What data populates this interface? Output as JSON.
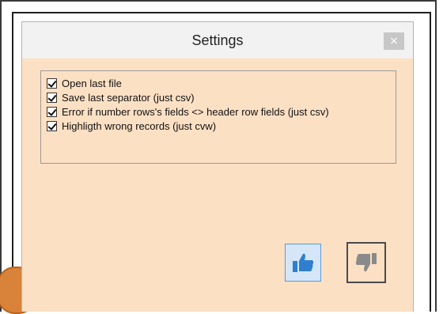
{
  "window": {
    "title": "Settings",
    "close_glyph": "×"
  },
  "options": [
    {
      "label": "Open last file",
      "checked": true
    },
    {
      "label": "Save last separator (just csv)",
      "checked": true
    },
    {
      "label": "Error if number rows's fields <> header row fields (just csv)",
      "checked": true
    },
    {
      "label": "Highligth wrong records (just cvw)",
      "checked": true
    }
  ],
  "buttons": {
    "ok_icon": "thumbs-up-icon",
    "cancel_icon": "thumbs-down-icon"
  },
  "colors": {
    "window_bg": "#fce0c4",
    "title_bg": "#f2f2f2",
    "ok_blue": "#2e7fd0",
    "cancel_gray": "#8a8a8a"
  }
}
